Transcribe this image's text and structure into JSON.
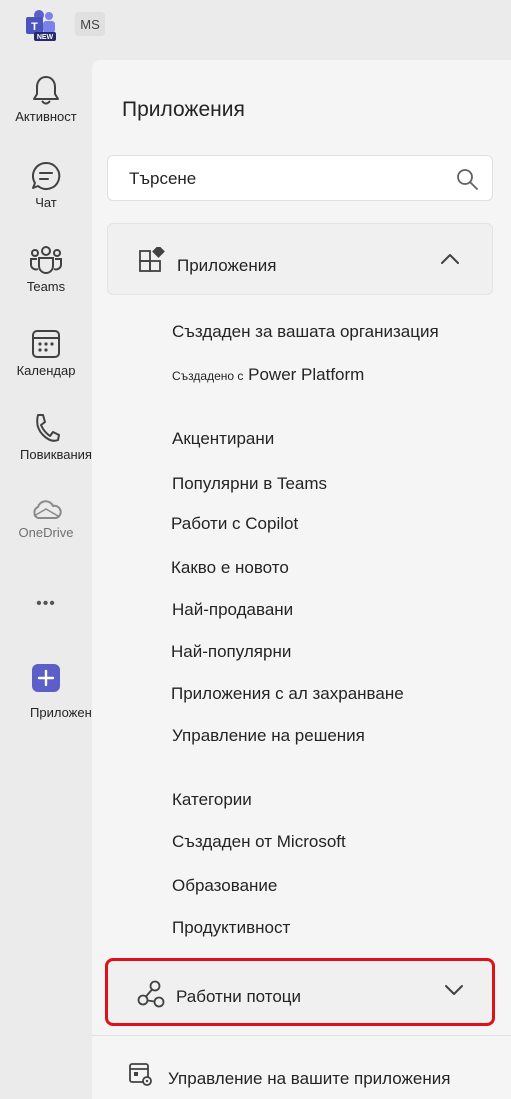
{
  "topbar": {
    "logo_badge": "NEW",
    "user_initials": "MS"
  },
  "rail": {
    "items": [
      {
        "label": "Активност",
        "icon": "bell-icon"
      },
      {
        "label": "Чат",
        "icon": "chat-icon"
      },
      {
        "label": "Teams",
        "icon": "teams-icon"
      },
      {
        "label": "Календар",
        "icon": "calendar-icon"
      },
      {
        "label": "Повиквания",
        "icon": "phone-icon"
      },
      {
        "label": "OneDrive",
        "icon": "cloud-icon"
      },
      {
        "label": "•••",
        "icon": "more-icon"
      },
      {
        "label": "Приложения",
        "icon": "plus-icon"
      }
    ]
  },
  "panel": {
    "title": "Приложения",
    "search": {
      "placeholder": "Търсене"
    },
    "apps_section": {
      "label": "Приложения",
      "expanded": true
    },
    "links_group1": {
      "built_for_org": "Създаден за вашата организация",
      "built_with_prefix": "Създадено с",
      "built_with_product": "Power Platform"
    },
    "links_group2": [
      "Акцентирани",
      "Популярни в Teams",
      "Работи с Copilot",
      "Какво е новото",
      "Най-продавани",
      "Най-популярни",
      "Приложения с ал захранване",
      "Управление на решения"
    ],
    "links_group3": [
      "Категории",
      "Създаден от Microsoft",
      "Образование",
      "Продуктивност"
    ],
    "workflows_section": {
      "label": "Работни потоци",
      "expanded": false
    },
    "manage_apps": "Управление на вашите приложения"
  },
  "colors": {
    "accent": "#5b5fc7",
    "highlight": "#e0101a"
  }
}
